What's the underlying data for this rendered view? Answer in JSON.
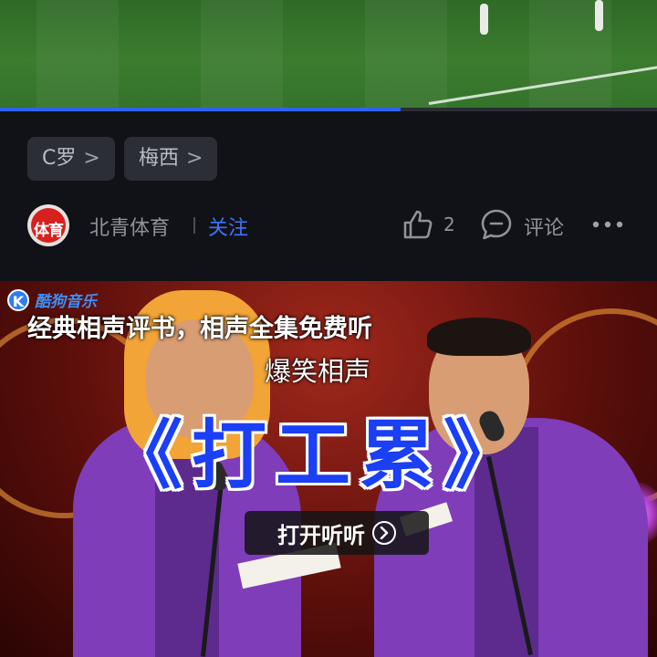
{
  "video": {
    "progress_percent": 61,
    "accent_color": "#2e63f0"
  },
  "tags": [
    {
      "label": "C罗",
      "chevron": ">"
    },
    {
      "label": "梅西",
      "chevron": ">"
    }
  ],
  "author": {
    "avatar_text": "体育",
    "name": "北青体育",
    "follow_label": "关注",
    "follow_color": "#3f73ff"
  },
  "actions": {
    "like_icon": "thumbs-up-icon",
    "like_count": "2",
    "comment_icon": "comment-icon",
    "comment_label": "评论",
    "more_icon": "more-dots-icon"
  },
  "ad": {
    "brand_icon_letter": "K",
    "brand_name": "酷狗音乐",
    "headline": "经典相声评书，相声全集免费听",
    "subtitle": "爆笑相声",
    "big_title": "《打工累》",
    "cta_label": "打开听听",
    "cta_icon": "chevron-right-circle-icon"
  }
}
